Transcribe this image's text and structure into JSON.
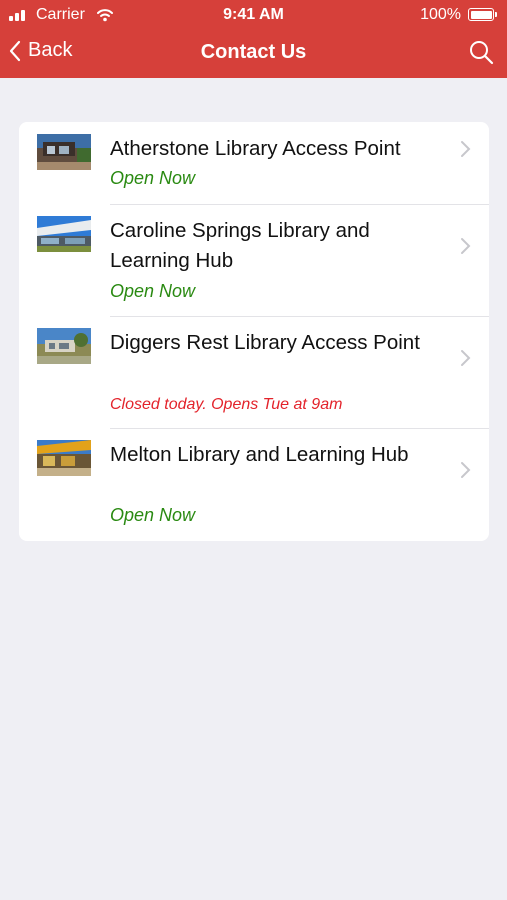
{
  "status_bar": {
    "carrier": "Carrier",
    "time": "9:41 AM",
    "battery": "100%"
  },
  "nav": {
    "back_label": "Back",
    "title": "Contact Us"
  },
  "colors": {
    "header": "#d6403a",
    "open": "#2a8a12",
    "closed": "#e3232b",
    "background": "#efeff4"
  },
  "libraries": [
    {
      "name": "Atherstone Library Access Point",
      "status": "Open Now",
      "status_type": "open"
    },
    {
      "name": "Caroline Springs Library and Learning Hub",
      "status": "Open Now",
      "status_type": "open"
    },
    {
      "name": "Diggers Rest Library Access Point",
      "status": "Closed today. Opens Tue at 9am",
      "status_type": "closed"
    },
    {
      "name": "Melton Library and Learning Hub",
      "status": "Open Now",
      "status_type": "open"
    }
  ]
}
